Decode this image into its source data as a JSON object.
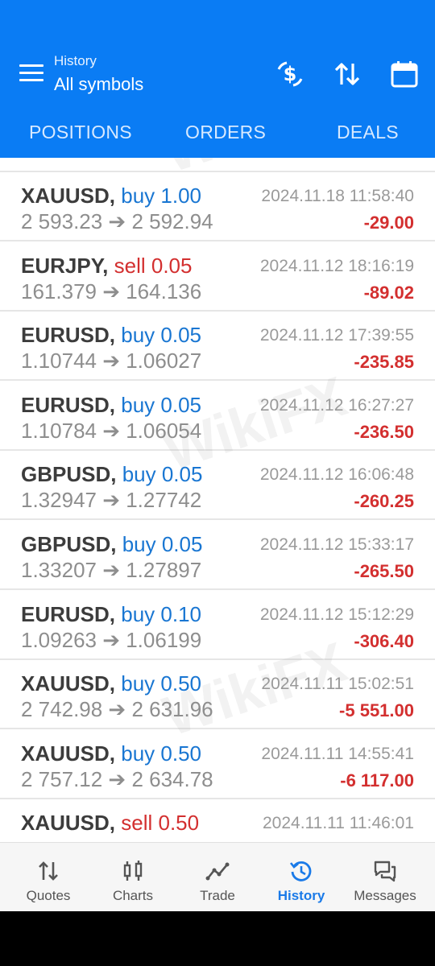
{
  "header": {
    "subtitle": "History",
    "title": "All symbols",
    "icons": [
      "currency-swap-icon",
      "sort-icon",
      "calendar-icon"
    ]
  },
  "tabs": [
    {
      "label": "POSITIONS"
    },
    {
      "label": "ORDERS"
    },
    {
      "label": "DEALS"
    }
  ],
  "deals": [
    {
      "symbol": "XAUUSD,",
      "direction": "buy",
      "volume": "buy 1.00",
      "prices": "2 593.23 ➔ 2 592.94",
      "time": "2024.11.18 11:58:40",
      "profit": "-29.00"
    },
    {
      "symbol": "EURJPY,",
      "direction": "sell",
      "volume": "sell 0.05",
      "prices": "161.379 ➔ 164.136",
      "time": "2024.11.12 18:16:19",
      "profit": "-89.02"
    },
    {
      "symbol": "EURUSD,",
      "direction": "buy",
      "volume": "buy 0.05",
      "prices": "1.10744 ➔ 1.06027",
      "time": "2024.11.12 17:39:55",
      "profit": "-235.85"
    },
    {
      "symbol": "EURUSD,",
      "direction": "buy",
      "volume": "buy 0.05",
      "prices": "1.10784 ➔ 1.06054",
      "time": "2024.11.12 16:27:27",
      "profit": "-236.50"
    },
    {
      "symbol": "GBPUSD,",
      "direction": "buy",
      "volume": "buy 0.05",
      "prices": "1.32947 ➔ 1.27742",
      "time": "2024.11.12 16:06:48",
      "profit": "-260.25"
    },
    {
      "symbol": "GBPUSD,",
      "direction": "buy",
      "volume": "buy 0.05",
      "prices": "1.33207 ➔ 1.27897",
      "time": "2024.11.12 15:33:17",
      "profit": "-265.50"
    },
    {
      "symbol": "EURUSD,",
      "direction": "buy",
      "volume": "buy 0.10",
      "prices": "1.09263 ➔ 1.06199",
      "time": "2024.11.12 15:12:29",
      "profit": "-306.40"
    },
    {
      "symbol": "XAUUSD,",
      "direction": "buy",
      "volume": "buy 0.50",
      "prices": "2 742.98 ➔ 2 631.96",
      "time": "2024.11.11 15:02:51",
      "profit": "-5 551.00"
    },
    {
      "symbol": "XAUUSD,",
      "direction": "buy",
      "volume": "buy 0.50",
      "prices": "2 757.12 ➔ 2 634.78",
      "time": "2024.11.11 14:55:41",
      "profit": "-6 117.00"
    },
    {
      "symbol": "XAUUSD,",
      "direction": "sell",
      "volume": "sell 0.50",
      "prices": "",
      "time": "2024.11.11 11:46:01",
      "profit": ""
    }
  ],
  "nav": [
    {
      "label": "Quotes",
      "icon": "quotes-icon"
    },
    {
      "label": "Charts",
      "icon": "charts-icon"
    },
    {
      "label": "Trade",
      "icon": "trade-icon"
    },
    {
      "label": "History",
      "icon": "history-icon",
      "active": true
    },
    {
      "label": "Messages",
      "icon": "messages-icon"
    }
  ],
  "watermark": "WikiFX",
  "colors": {
    "accent": "#0a7cf4",
    "buy": "#1976d2",
    "sell": "#d32f2f",
    "loss": "#d32f2f"
  }
}
